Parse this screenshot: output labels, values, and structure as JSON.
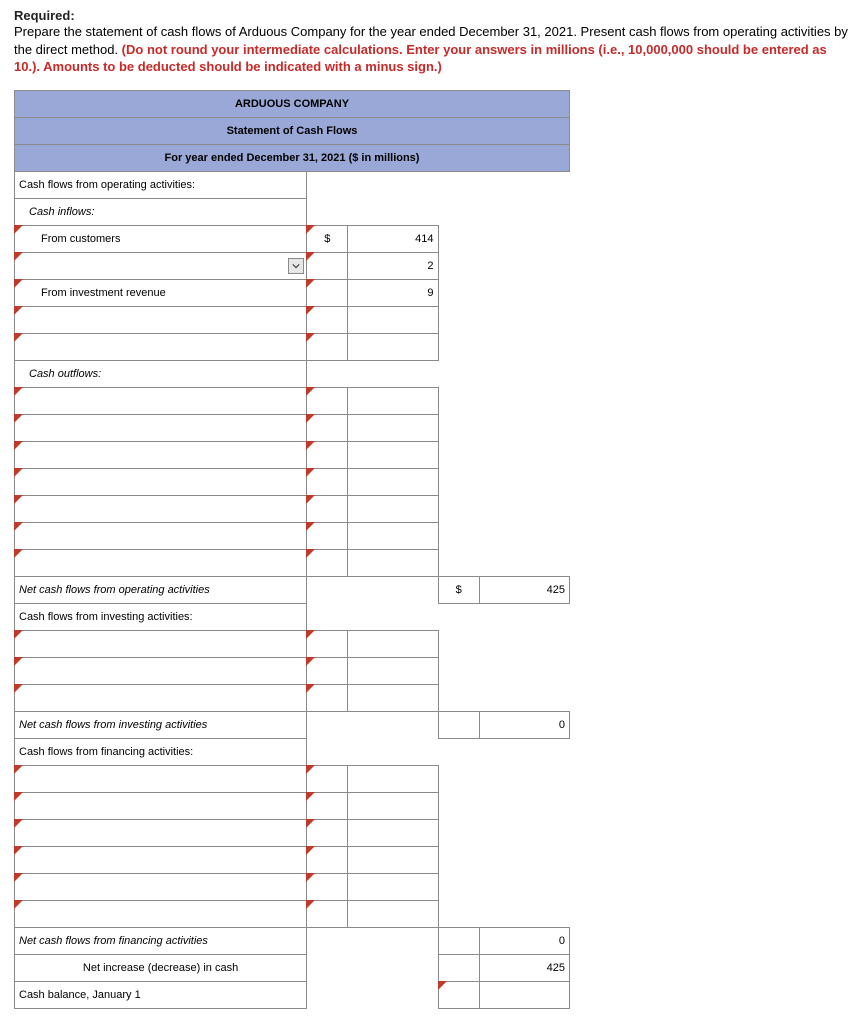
{
  "header": {
    "required_label": "Required:",
    "instr_black": "Prepare the statement of cash flows of Arduous Company for the year ended December 31, 2021. Present cash flows from operating activities by the direct method. ",
    "instr_red": "(Do not round your intermediate calculations. Enter your answers in millions (i.e., 10,000,000 should be entered as 10.). Amounts to be deducted should be indicated with a minus sign.)"
  },
  "title": {
    "company": "ARDUOUS COMPANY",
    "statement": "Statement of Cash Flows",
    "period": "For year ended December 31, 2021 ($ in millions)"
  },
  "labels": {
    "op_header": "Cash flows from operating activities:",
    "inflows": "Cash inflows:",
    "from_customers": "From customers",
    "from_invest_rev": "From investment revenue",
    "outflows": "Cash outflows:",
    "net_op": "Net cash flows from operating activities",
    "inv_header": "Cash flows from investing activities:",
    "net_inv": "Net cash flows from investing activities",
    "fin_header": "Cash flows from financing activities:",
    "net_fin": "Net cash flows from financing activities",
    "net_change": "Net increase (decrease) in cash",
    "cash_jan1": "Cash balance, January 1"
  },
  "sym": {
    "dollar": "$"
  },
  "values": {
    "from_customers": "414",
    "row_blank1": "2",
    "from_invest_rev": "9",
    "net_op": "425",
    "net_inv": "0",
    "net_fin": "0",
    "net_change": "425"
  }
}
